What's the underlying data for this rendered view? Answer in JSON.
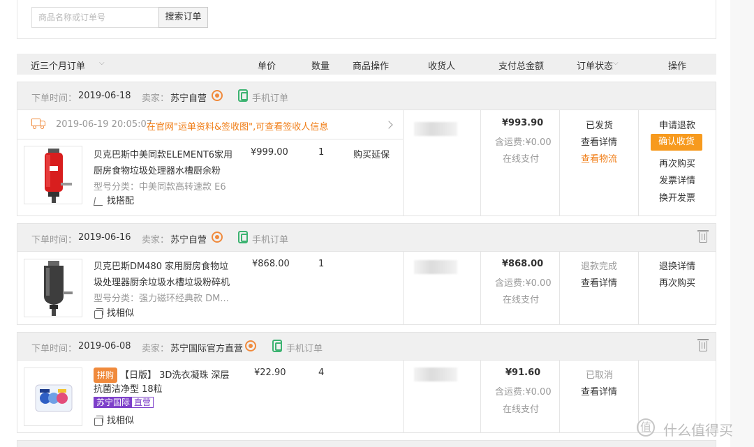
{
  "search": {
    "placeholder": "商品名称或订单号",
    "button": "搜索订单"
  },
  "table_header": {
    "range": "近三个月订单",
    "price": "单价",
    "qty": "数量",
    "product_op": "商品操作",
    "receiver": "收货人",
    "total": "支付总金额",
    "status": "订单状态",
    "actions": "操作"
  },
  "labels": {
    "order_time": "下单时间：",
    "seller": "卖家：",
    "mobile_order": "手机订单"
  },
  "orders": [
    {
      "date": "2019-06-18",
      "seller": "苏宁自营",
      "logistics": {
        "time": "2019-06-19 20:05:07",
        "message": "在官网\"运单资料&签收图\",可查看签收人信息"
      },
      "product": {
        "name": "贝克巴斯中美同款ELEMENT6家用厨房食物垃圾处理器水槽厨余粉",
        "model": "型号分类：中美同款高转速款 E6",
        "price": "¥999.00",
        "qty": "1",
        "product_op": "购买延保",
        "sub_action": "找搭配"
      },
      "total": "¥993.90",
      "shipping": "含运费:¥0.00",
      "pay_method": "在线支付",
      "status": "已发货",
      "status_link": "查看详情",
      "status_extra": "查看物流",
      "actions": [
        "申请退款",
        "确认收货",
        "再次购买",
        "发票详情",
        "换开发票"
      ]
    },
    {
      "date": "2019-06-16",
      "seller": "苏宁自营",
      "product": {
        "name": "贝克巴斯DM480 家用厨房食物垃圾处理器厨余垃圾水槽垃圾粉碎机",
        "model": "型号分类：强力磁环经典款 DM...",
        "price": "¥868.00",
        "qty": "1",
        "sub_action": "找相似"
      },
      "total": "¥868.00",
      "shipping": "含运费:¥0.00",
      "pay_method": "在线支付",
      "status": "退款完成",
      "status_link": "查看详情",
      "actions": [
        "退换详情",
        "再次购买"
      ]
    },
    {
      "date": "2019-06-08",
      "seller": "苏宁国际官方直营",
      "product": {
        "tag": "拼购",
        "name": "【日版】 3D洗衣凝珠 深层抗菌洁净型 18粒",
        "intl_tag_a": "苏宁国际",
        "intl_tag_b": "直营",
        "price": "¥22.90",
        "qty": "4",
        "sub_action": "找相似"
      },
      "total": "¥91.60",
      "shipping": "含运费:¥0.00",
      "pay_method": "在线支付",
      "status": "已取消",
      "status_link": "查看详情"
    }
  ],
  "watermark": {
    "symbol": "值",
    "text": "什么值得买"
  },
  "colors": {
    "accent_orange": "#f07d16",
    "button_orange": "#f79a1e",
    "mobile_green": "#3cb371",
    "intl_purple": "#7d3fc9"
  }
}
